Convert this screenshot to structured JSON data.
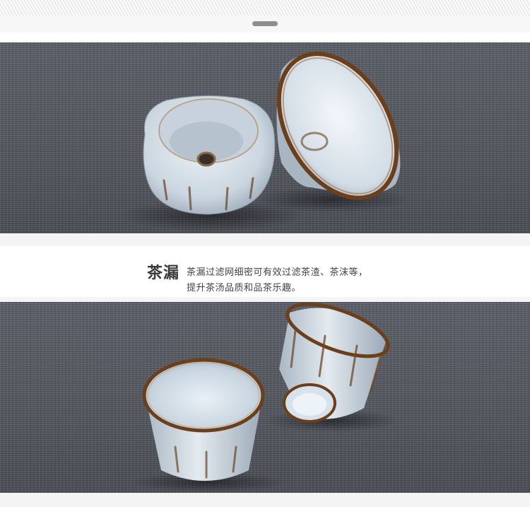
{
  "caption": {
    "title": "茶漏",
    "line1": "茶漏过滤网细密可有效过滤茶渣、茶沫等，",
    "line2": "提升茶汤品质和品茶乐趣。"
  },
  "colors": {
    "backdrop": "#5a5d66",
    "glaze": "#d9e2ea",
    "rim": "#6b3f1c",
    "caption_text": "#3a3a3a"
  },
  "icons": {
    "top_handle": "drag-handle-icon"
  }
}
